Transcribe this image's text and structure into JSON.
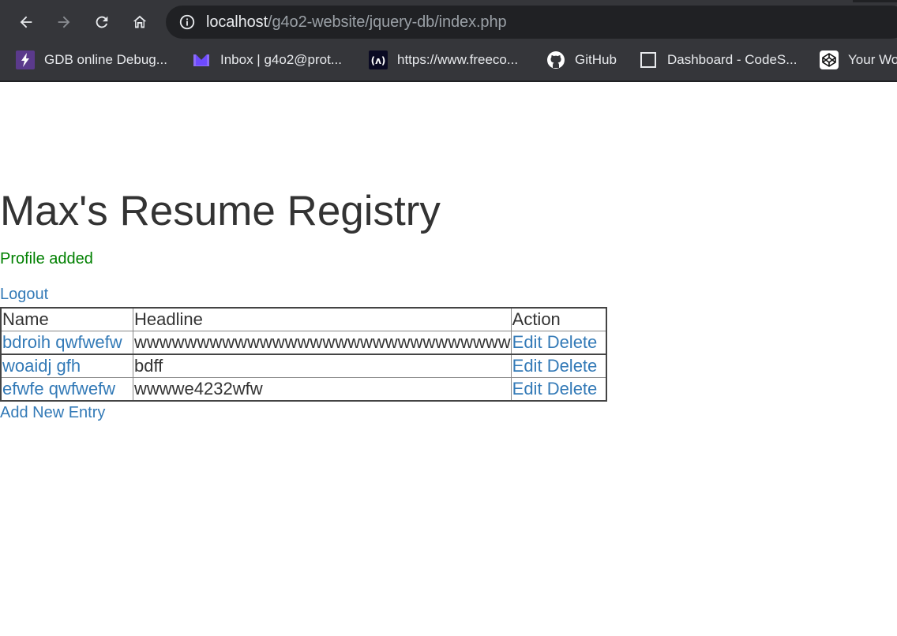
{
  "browser": {
    "url_host": "localhost",
    "url_path": "/g4o2-website/jquery-db/index.php",
    "bookmarks": [
      {
        "label": "GDB online Debug...",
        "icon": "gdb-bolt-icon"
      },
      {
        "label": "Inbox | g4o2@prot...",
        "icon": "protonmail-icon"
      },
      {
        "label": "https://www.freeco...",
        "icon": "freecodecamp-icon"
      },
      {
        "label": "GitHub",
        "icon": "github-icon"
      },
      {
        "label": "Dashboard - CodeS...",
        "icon": "blank-page-icon"
      },
      {
        "label": "Your Wo",
        "icon": "codepen-icon"
      }
    ]
  },
  "page": {
    "title": "Max's Resume Registry",
    "flash": "Profile added",
    "logout": "Logout",
    "add_new": "Add New Entry",
    "table": {
      "headers": [
        "Name",
        "Headline",
        "Action"
      ],
      "rows": [
        {
          "name": "bdroih qwfwefw",
          "headline": "wwwwwwwwwwwwwwwwwwwwwwwwwwwwww",
          "edit": "Edit",
          "delete": "Delete"
        },
        {
          "name": "woaidj gfh",
          "headline": "bdff",
          "edit": "Edit",
          "delete": "Delete"
        },
        {
          "name": "efwfe qwfwefw",
          "headline": "wwwwe4232wfw",
          "edit": "Edit",
          "delete": "Delete"
        }
      ]
    }
  },
  "colors": {
    "chrome_bg": "#35363a",
    "omnibox_bg": "#202124",
    "flash": "#008000",
    "link": "#337ab7"
  }
}
